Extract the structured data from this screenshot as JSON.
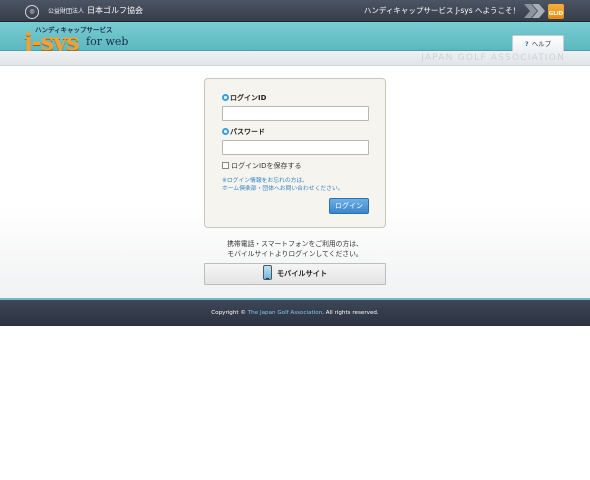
{
  "topbar": {
    "logo_text": "GJA",
    "org_prefix": "公益財団法人",
    "org_name": "日本ゴルフ協会",
    "welcome": "ハンディキャップサービス J-sys へようこそ！",
    "badge": "GLiD"
  },
  "header": {
    "tagline": "ハンディキャップサービス",
    "brand_main": "j-sys",
    "brand_sub": "for web",
    "help_label": "ヘルプ",
    "association": "JAPAN  GOLF  ASSOCIATION"
  },
  "login": {
    "id_label": "ログインID",
    "id_value": "",
    "password_label": "パスワード",
    "password_value": "",
    "remember_label": "ログインIDを保存する",
    "forgot_line1": "※ログイン情報をお忘れの方は、",
    "forgot_line2": "ホーム倶楽部・団体へお問い合わせください。",
    "button": "ログイン"
  },
  "mobile": {
    "note_line1": "携帯電話・スマートフォンをご利用の方は、",
    "note_line2": "モバイルサイトよりログインしてください。",
    "button": "モバイルサイト"
  },
  "footer": {
    "prefix": "Copyright ©",
    "org": "The Japan Golf Association",
    "suffix": ". All rights reserved."
  }
}
